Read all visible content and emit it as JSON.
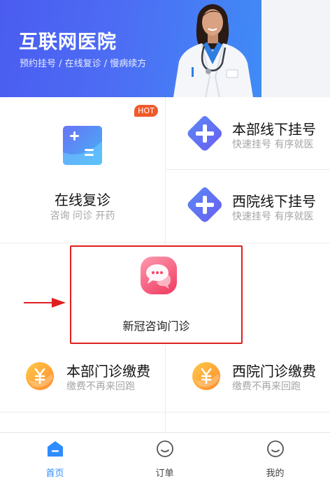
{
  "banner": {
    "title": "互联网医院",
    "subtitle": "预约挂号 / 在线复诊 / 慢病续方"
  },
  "services": {
    "online_revisit": {
      "title": "在线复诊",
      "subtitle": "咨询 问诊 开药",
      "badge": "HOT"
    },
    "main_register": {
      "title": "本部线下挂号",
      "subtitle": "快速挂号 有序就医"
    },
    "west_register": {
      "title": "西院线下挂号",
      "subtitle": "快速挂号 有序就医"
    },
    "covid_consult": {
      "title": "新冠咨询门诊"
    },
    "main_payment": {
      "title": "本部门诊缴费",
      "subtitle": "缴费不再来回跑"
    },
    "west_payment": {
      "title": "西院门诊缴费",
      "subtitle": "缴费不再来回跑"
    }
  },
  "tabs": [
    {
      "label": "首页",
      "icon": "home-icon",
      "active": true
    },
    {
      "label": "订单",
      "icon": "smile-icon",
      "active": false
    },
    {
      "label": "我的",
      "icon": "smile-icon",
      "active": false
    }
  ],
  "colors": {
    "banner_start": "#4a5cf0",
    "banner_end": "#3f8cf6",
    "hot_badge": "#f05a2a",
    "highlight_frame": "#e01f1f",
    "active_tab": "#2f8cff",
    "subtitle_gray": "#a5a5a5"
  }
}
